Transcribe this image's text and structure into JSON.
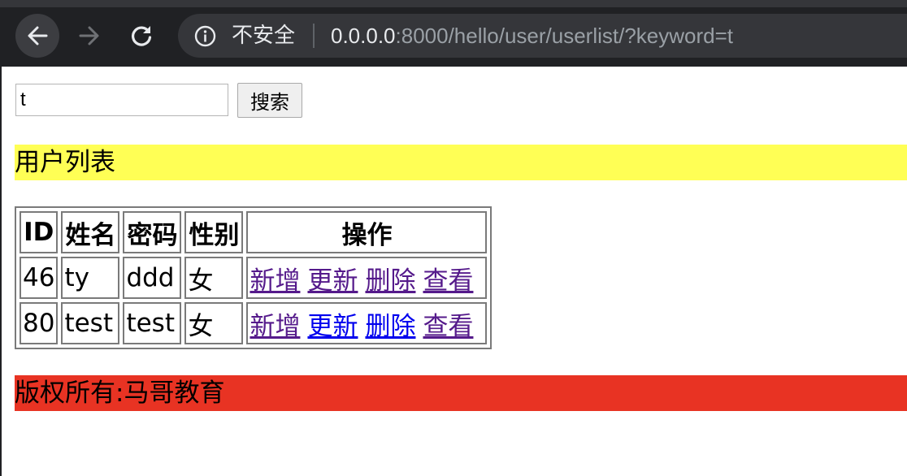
{
  "browser": {
    "security_label": "不安全",
    "url_host": "0.0.0.0",
    "url_rest": ":8000/hello/user/userlist/?keyword=t"
  },
  "search": {
    "value": "t",
    "button_label": "搜索"
  },
  "list_title": "用户列表",
  "table": {
    "headers": [
      "ID",
      "姓名",
      "密码",
      "性别",
      "操作"
    ],
    "rows": [
      {
        "id": "46",
        "name": "ty",
        "password": "ddd",
        "gender": "女",
        "actions": [
          "新增",
          "更新",
          "删除",
          "查看"
        ]
      },
      {
        "id": "80",
        "name": "test",
        "password": "test",
        "gender": "女",
        "actions": [
          "新增",
          "更新",
          "删除",
          "查看"
        ]
      }
    ]
  },
  "footer": "版权所有:马哥教育",
  "colors": {
    "title_band": "#ffff55",
    "footer_band": "#e83323",
    "link_visited": "#551a8b",
    "link_unvisited": "#0000ee"
  }
}
